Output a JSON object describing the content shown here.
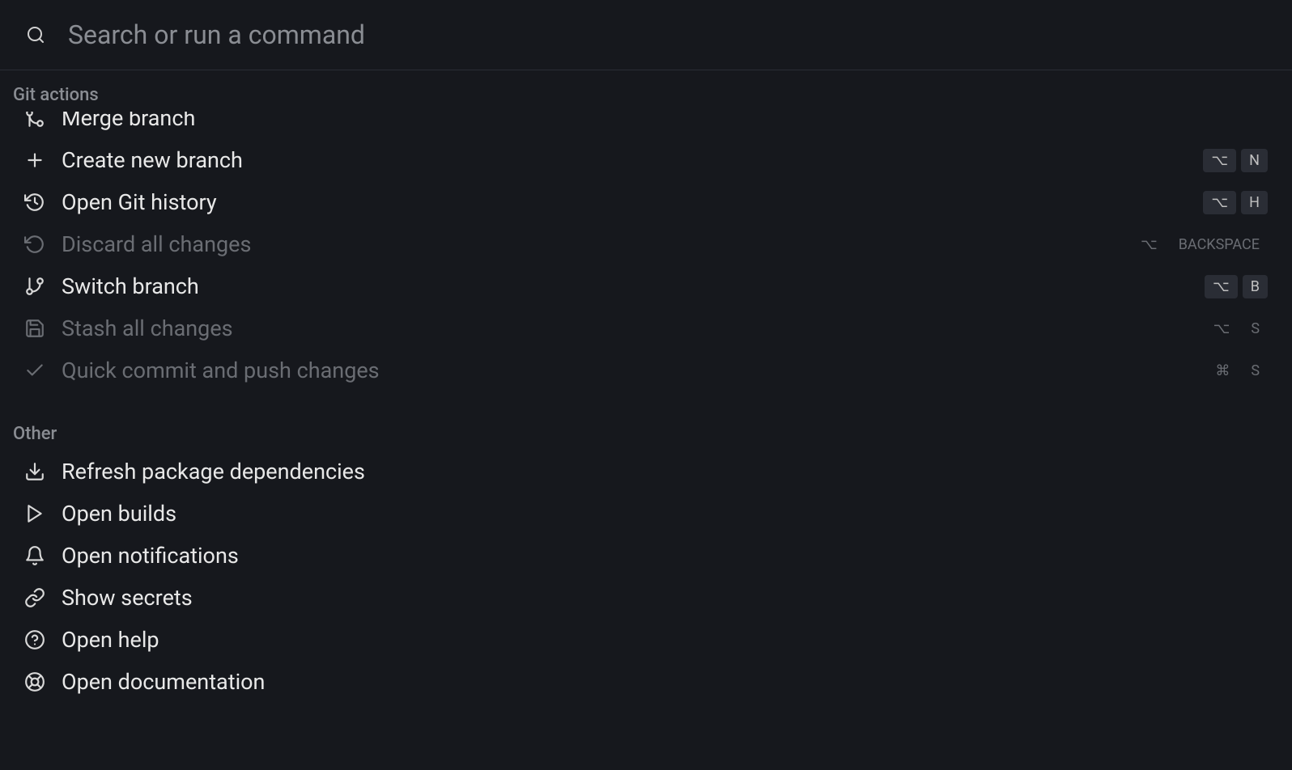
{
  "search": {
    "placeholder": "Search or run a command"
  },
  "sections": {
    "git": {
      "header": "Git actions",
      "items": [
        {
          "label": "Merge branch",
          "icon": "merge-icon",
          "disabled": false,
          "partial": true,
          "shortcut": []
        },
        {
          "label": "Create new branch",
          "icon": "plus-icon",
          "disabled": false,
          "shortcut": [
            "⌥",
            "N"
          ]
        },
        {
          "label": "Open Git history",
          "icon": "history-icon",
          "disabled": false,
          "shortcut": [
            "⌥",
            "H"
          ]
        },
        {
          "label": "Discard all changes",
          "icon": "undo-icon",
          "disabled": true,
          "shortcut": [
            "⌥",
            "BACKSPACE"
          ]
        },
        {
          "label": "Switch branch",
          "icon": "branch-icon",
          "disabled": false,
          "shortcut": [
            "⌥",
            "B"
          ]
        },
        {
          "label": "Stash all changes",
          "icon": "save-icon",
          "disabled": true,
          "shortcut": [
            "⌥",
            "S"
          ]
        },
        {
          "label": "Quick commit and push changes",
          "icon": "check-icon",
          "disabled": true,
          "shortcut": [
            "⌘",
            "S"
          ]
        }
      ]
    },
    "other": {
      "header": "Other",
      "items": [
        {
          "label": "Refresh package dependencies",
          "icon": "download-icon",
          "disabled": false,
          "shortcut": []
        },
        {
          "label": "Open builds",
          "icon": "play-icon",
          "disabled": false,
          "shortcut": []
        },
        {
          "label": "Open notifications",
          "icon": "bell-icon",
          "disabled": false,
          "shortcut": []
        },
        {
          "label": "Show secrets",
          "icon": "link-icon",
          "disabled": false,
          "shortcut": []
        },
        {
          "label": "Open help",
          "icon": "help-icon",
          "disabled": false,
          "shortcut": []
        },
        {
          "label": "Open documentation",
          "icon": "lifebuoy-icon",
          "disabled": false,
          "shortcut": []
        }
      ]
    }
  }
}
